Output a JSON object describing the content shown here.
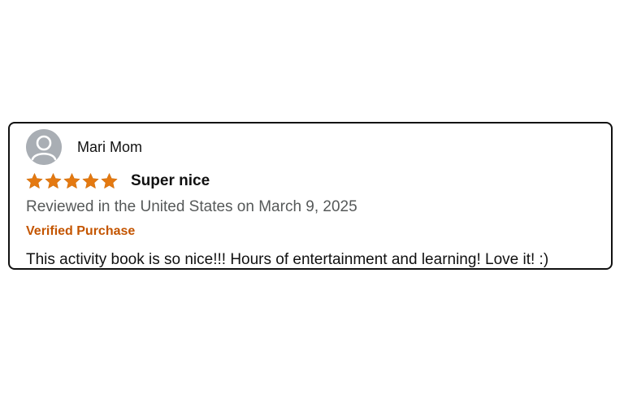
{
  "review": {
    "reviewer_name": "Mari Mom",
    "avatar_icon": "user-avatar-icon",
    "rating": 5,
    "rating_max": 5,
    "star_icon": "star-icon",
    "star_color": "#e47911",
    "title": "Super nice",
    "date_text": "Reviewed in the United States on March 9, 2025",
    "verified_label": "Verified Purchase",
    "verified_color": "#c45500",
    "body": "This activity book is so nice!!! Hours of entertainment and learning! Love it! :)"
  }
}
